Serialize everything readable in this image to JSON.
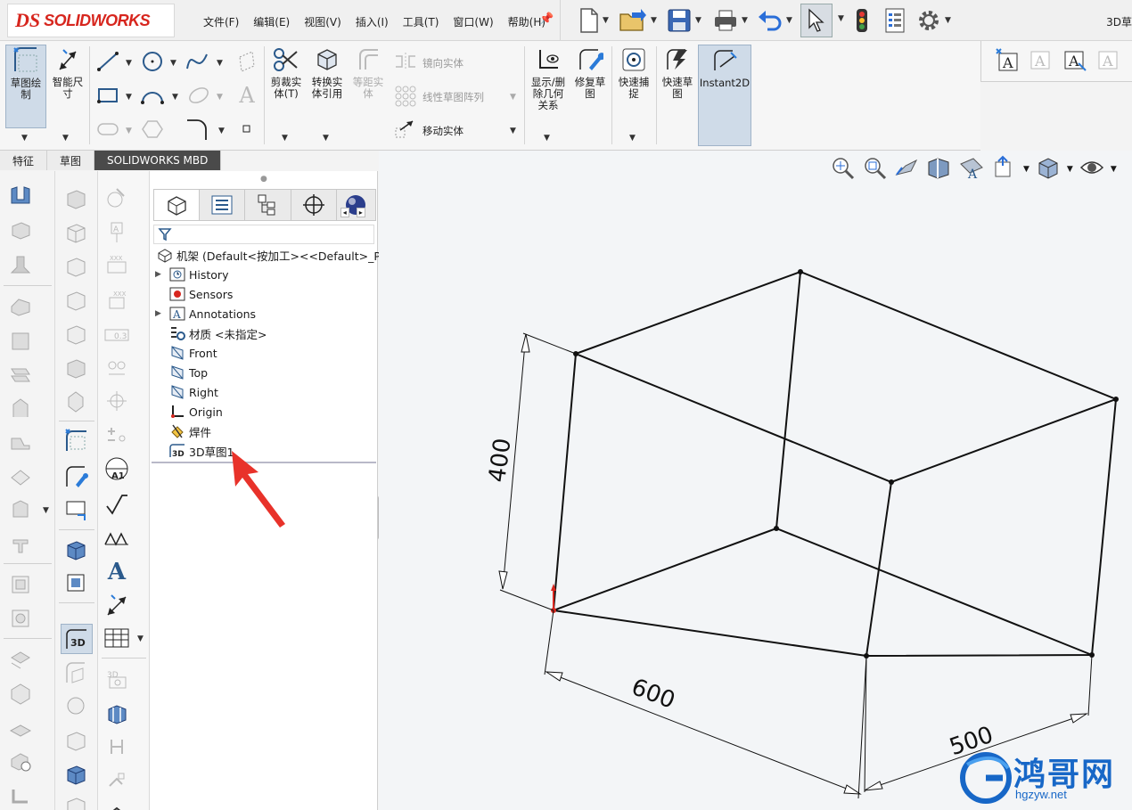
{
  "app": {
    "logo_ds": "DS",
    "logo_text": "SOLIDWORKS",
    "doc_title": "3D草"
  },
  "menu": [
    "文件(F)",
    "编辑(E)",
    "视图(V)",
    "插入(I)",
    "工具(T)",
    "窗口(W)",
    "帮助(H)"
  ],
  "command_manager": {
    "sketch": "草图绘\n制",
    "smart_dim": "智能尺\n寸",
    "trim": "剪裁实\n体(T)",
    "convert": "转换实\n体引用",
    "offset": "等距实\n体",
    "mirror": "镜向实体",
    "linear_pattern": "线性草图阵列",
    "move": "移动实体",
    "display_relations": "显示/删\n除几何\n关系",
    "repair": "修复草\n图",
    "quick_snaps": "快速捕\n捉",
    "rapid_sketch": "快速草\n图",
    "instant2d": "Instant2D"
  },
  "tabs": [
    {
      "label": "特征",
      "active": false
    },
    {
      "label": "草图",
      "active": false
    },
    {
      "label": "SOLIDWORKS MBD",
      "active": true
    }
  ],
  "tree": {
    "root": "机架  (Default<按加工><<Default>_Pho",
    "items": [
      {
        "label": "History",
        "icon": "history-icon",
        "expandable": true
      },
      {
        "label": "Sensors",
        "icon": "sensors-icon",
        "expandable": false
      },
      {
        "label": "Annotations",
        "icon": "annotations-icon",
        "expandable": true
      },
      {
        "label": "材质 <未指定>",
        "icon": "material-icon",
        "expandable": false
      },
      {
        "label": "Front",
        "icon": "plane-icon",
        "expandable": false
      },
      {
        "label": "Top",
        "icon": "plane-icon",
        "expandable": false
      },
      {
        "label": "Right",
        "icon": "plane-icon",
        "expandable": false
      },
      {
        "label": "Origin",
        "icon": "origin-icon",
        "expandable": false
      },
      {
        "label": "焊件",
        "icon": "weldment-icon",
        "expandable": false
      },
      {
        "label": "3D草图1",
        "icon": "sketch3d-icon",
        "expandable": false
      }
    ]
  },
  "model": {
    "dim_height": "400",
    "dim_length": "600",
    "dim_width": "500"
  },
  "watermark": {
    "text": "鸿哥网",
    "url": "hgzyw.net"
  },
  "colors": {
    "accent": "#d7261e",
    "active_tab": "#4a4a4a",
    "highlight": "#cfdbe8",
    "arrow": "#e8322a"
  }
}
